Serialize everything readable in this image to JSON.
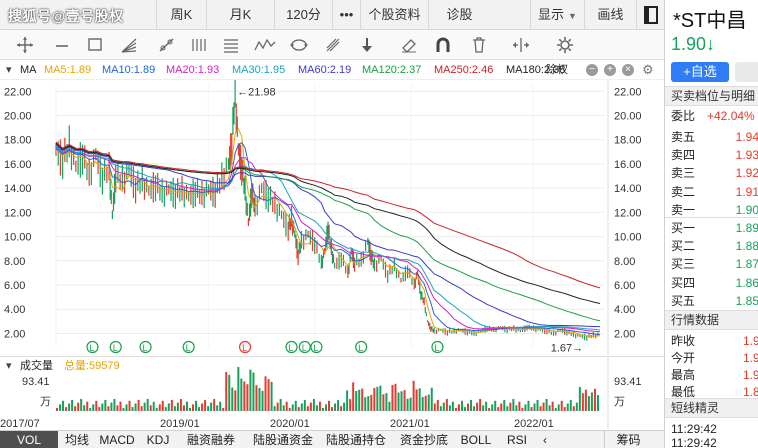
{
  "watermark": "搜狐号@壹号股权",
  "top_tabs": [
    {
      "label": "周K"
    },
    {
      "label": "月K"
    },
    {
      "label": "120分"
    },
    {
      "label": "•••"
    },
    {
      "label": "个股资料"
    },
    {
      "label": "诊股"
    },
    {
      "label": "显示"
    },
    {
      "label": "画线"
    }
  ],
  "toolbar_icons": [
    "crosshair-icon",
    "line-icon",
    "rect-icon",
    "fan-icon",
    "pencil-line-icon",
    "parallel-icon",
    "fib-icon",
    "wave-icon",
    "cycle-icon",
    "gann-icon",
    "arrow-down-icon",
    "eraser-icon",
    "magnet-icon",
    "trash-icon",
    "split-icon",
    "settings-icon"
  ],
  "ma_bar": {
    "label": "MA",
    "items": [
      {
        "text": "MA5:1.89",
        "color": "#e6a400"
      },
      {
        "text": "MA10:1.89",
        "color": "#2266dd"
      },
      {
        "text": "MA20:1.93",
        "color": "#d020c8"
      },
      {
        "text": "MA30:1.95",
        "color": "#1aa3c0"
      },
      {
        "text": "MA60:2.19",
        "color": "#3a3ac8"
      },
      {
        "text": "MA120:2.37",
        "color": "#18a04a"
      },
      {
        "text": "MA250:2.46",
        "color": "#cc2222"
      },
      {
        "text": "MA180:2.38",
        "color": "#222222"
      }
    ],
    "adjust": "除权",
    "buttons": [
      "−",
      "+",
      "×"
    ]
  },
  "chart_data": {
    "type": "line",
    "title": "",
    "y_ticks": [
      "22.00",
      "20.00",
      "18.00",
      "16.00",
      "14.00",
      "12.00",
      "10.00",
      "8.00",
      "6.00",
      "4.00",
      "2.00"
    ],
    "ylim": [
      0.8,
      22.6
    ],
    "x_ticks": [
      "2017/07",
      "2019/01",
      "2020/01",
      "2021/01",
      "2022/01"
    ],
    "annotations": {
      "high": "←21.98",
      "low": "1.67→"
    },
    "price_series": [
      [
        0,
        17.2
      ],
      [
        4,
        16.2
      ],
      [
        8,
        17.6
      ],
      [
        12,
        15.8
      ],
      [
        16,
        16.6
      ],
      [
        20,
        15.1
      ],
      [
        24,
        16.8
      ],
      [
        28,
        14.8
      ],
      [
        32,
        15.6
      ],
      [
        34,
        11.8
      ],
      [
        36,
        15.0
      ],
      [
        40,
        14.6
      ],
      [
        44,
        15.5
      ],
      [
        48,
        14.0
      ],
      [
        52,
        14.6
      ],
      [
        56,
        13.8
      ],
      [
        60,
        14.2
      ],
      [
        64,
        13.6
      ],
      [
        68,
        13.9
      ],
      [
        72,
        13.5
      ],
      [
        76,
        13.8
      ],
      [
        80,
        13.3
      ],
      [
        84,
        13.7
      ],
      [
        88,
        13.4
      ],
      [
        92,
        13.9
      ],
      [
        96,
        13.6
      ],
      [
        100,
        14.8
      ],
      [
        104,
        16.0
      ],
      [
        106,
        17.5
      ],
      [
        108,
        21.98
      ],
      [
        110,
        17.2
      ],
      [
        112,
        15.6
      ],
      [
        114,
        13.8
      ],
      [
        116,
        11.2
      ],
      [
        118,
        13.6
      ],
      [
        120,
        12.4
      ],
      [
        124,
        14.0
      ],
      [
        128,
        13.2
      ],
      [
        132,
        12.6
      ],
      [
        136,
        11.8
      ],
      [
        140,
        10.6
      ],
      [
        142,
        11.5
      ],
      [
        144,
        10.2
      ],
      [
        146,
        8.4
      ],
      [
        148,
        9.6
      ],
      [
        152,
        10.2
      ],
      [
        156,
        9.4
      ],
      [
        160,
        7.8
      ],
      [
        162,
        8.8
      ],
      [
        164,
        10.6
      ],
      [
        166,
        9.0
      ],
      [
        168,
        7.6
      ],
      [
        172,
        8.2
      ],
      [
        176,
        7.0
      ],
      [
        178,
        8.8
      ],
      [
        180,
        7.8
      ],
      [
        184,
        8.0
      ],
      [
        188,
        9.6
      ],
      [
        190,
        8.4
      ],
      [
        192,
        7.6
      ],
      [
        196,
        8.2
      ],
      [
        200,
        6.8
      ],
      [
        204,
        7.6
      ],
      [
        208,
        6.4
      ],
      [
        212,
        7.2
      ],
      [
        216,
        6.0
      ],
      [
        218,
        7.0
      ],
      [
        220,
        5.2
      ],
      [
        222,
        4.6
      ],
      [
        224,
        3.0
      ],
      [
        226,
        2.4
      ],
      [
        228,
        2.2
      ],
      [
        232,
        2.3
      ],
      [
        236,
        2.1
      ],
      [
        240,
        2.2
      ],
      [
        244,
        2.3
      ],
      [
        248,
        2.1
      ],
      [
        252,
        2.0
      ],
      [
        256,
        2.2
      ],
      [
        260,
        2.4
      ],
      [
        264,
        2.3
      ],
      [
        268,
        2.5
      ],
      [
        272,
        2.3
      ],
      [
        276,
        2.4
      ],
      [
        280,
        2.2
      ],
      [
        284,
        2.5
      ],
      [
        288,
        2.4
      ],
      [
        292,
        2.3
      ],
      [
        296,
        2.2
      ],
      [
        300,
        2.0
      ],
      [
        304,
        2.3
      ],
      [
        308,
        2.1
      ],
      [
        312,
        1.9
      ],
      [
        316,
        1.8
      ],
      [
        320,
        1.67
      ],
      [
        324,
        1.85
      ],
      [
        328,
        1.9
      ]
    ],
    "ma_series": [
      {
        "name": "MA5",
        "color": "#e6a400",
        "offset": 0.0,
        "smooth": 2
      },
      {
        "name": "MA10",
        "color": "#2266dd",
        "offset": 0.1,
        "smooth": 4
      },
      {
        "name": "MA20",
        "color": "#d020c8",
        "offset": 0.2,
        "smooth": 7
      },
      {
        "name": "MA30",
        "color": "#1aa3c0",
        "offset": 0.25,
        "smooth": 10
      },
      {
        "name": "MA60",
        "color": "#3a3ac8",
        "offset": 0.4,
        "smooth": 18
      },
      {
        "name": "MA120",
        "color": "#18a04a",
        "offset": 0.5,
        "smooth": 30
      },
      {
        "name": "MA180",
        "color": "#222222",
        "offset": 0.5,
        "smooth": 42
      },
      {
        "name": "MA250",
        "color": "#cc2222",
        "offset": 0.6,
        "smooth": 55
      }
    ],
    "event_markers": [
      {
        "x": 22,
        "label": "L",
        "color": "#18a04a"
      },
      {
        "x": 36,
        "label": "L",
        "color": "#18a04a"
      },
      {
        "x": 54,
        "label": "L",
        "color": "#18a04a"
      },
      {
        "x": 80,
        "label": "L",
        "color": "#18a04a"
      },
      {
        "x": 114,
        "label": "L",
        "color": "#e63a2e"
      },
      {
        "x": 142,
        "label": "L",
        "color": "#18a04a"
      },
      {
        "x": 150,
        "label": "L",
        "color": "#18a04a"
      },
      {
        "x": 157,
        "label": "L",
        "color": "#18a04a"
      },
      {
        "x": 184,
        "label": "L",
        "color": "#18a04a"
      },
      {
        "x": 230,
        "label": "L",
        "color": "#18a04a"
      }
    ]
  },
  "volume": {
    "title": "成交量",
    "total_label": "总量:59579",
    "max_label": "93.41",
    "unit": "万"
  },
  "bottom_tabs": [
    {
      "label": "VOL",
      "active": true
    },
    {
      "label": "均线"
    },
    {
      "label": "MACD"
    },
    {
      "label": "KDJ"
    },
    {
      "label": "融资融券"
    },
    {
      "label": "陆股通资金"
    },
    {
      "label": "陆股通持仓"
    },
    {
      "label": "资金抄底"
    },
    {
      "label": "BOLL"
    },
    {
      "label": "RSI"
    },
    {
      "label": "筹码"
    }
  ],
  "right_panel": {
    "stock_name": "*ST中昌",
    "price": "1.90↓",
    "add_button": "+自选",
    "orderbook_title": "买卖档位与明细",
    "weibi_label": "委比",
    "weibi_value": "+42.04%",
    "orders": [
      {
        "label": "卖五",
        "value": "1.94",
        "color": "red"
      },
      {
        "label": "卖四",
        "value": "1.93",
        "color": "red"
      },
      {
        "label": "卖三",
        "value": "1.92",
        "color": "red"
      },
      {
        "label": "卖二",
        "value": "1.91",
        "color": "red"
      },
      {
        "label": "卖一",
        "value": "1.90",
        "color": "green"
      },
      {
        "label": "买一",
        "value": "1.89",
        "color": "green"
      },
      {
        "label": "买二",
        "value": "1.88",
        "color": "green"
      },
      {
        "label": "买三",
        "value": "1.87",
        "color": "green"
      },
      {
        "label": "买四",
        "value": "1.86",
        "color": "green"
      },
      {
        "label": "买五",
        "value": "1.85",
        "color": "green"
      }
    ],
    "quote_title": "行情数据",
    "quotes": [
      {
        "label": "昨收",
        "value": "1.9"
      },
      {
        "label": "今开",
        "value": "1.9"
      },
      {
        "label": "最高",
        "value": "1.9"
      },
      {
        "label": "最低",
        "value": "1.8"
      }
    ],
    "news_title": "短线精灵",
    "times": [
      "11:29:42",
      "11:29:42"
    ]
  }
}
